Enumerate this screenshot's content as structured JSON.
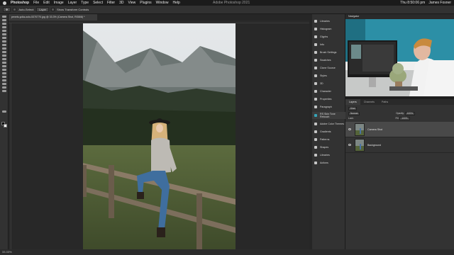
{
  "menubar": {
    "app": "Photoshop",
    "menus": [
      "File",
      "Edit",
      "Image",
      "Layer",
      "Type",
      "Select",
      "Filter",
      "3D",
      "View",
      "Plugins",
      "Window",
      "Help"
    ],
    "window_title": "Adobe Photoshop 2021",
    "clock": "Thu 8:50:06 pm",
    "user": "James Fosner"
  },
  "options_bar": {
    "select_label": "Auto-Select:",
    "select_value": "Layer",
    "transform_label": "Show Transform Controls"
  },
  "document": {
    "tab_title": "pexels-yulia-oolo-5370770.jpg @ 33.3% (Camera Shot, RGB/8) *"
  },
  "status": {
    "zoom": "33.33%"
  },
  "panels": [
    {
      "label": "Libraries",
      "icon": "libraries-icon"
    },
    {
      "label": "Histogram",
      "icon": "histogram-icon"
    },
    {
      "label": "Glyphs",
      "icon": "glyphs-icon"
    },
    {
      "label": "Info",
      "icon": "info-icon"
    },
    {
      "label": "Brush Settings",
      "icon": "brush-icon"
    },
    {
      "label": "Swatches",
      "icon": "swatches-icon"
    },
    {
      "label": "Clone Source",
      "icon": "clone-icon"
    },
    {
      "label": "Styles",
      "icon": "styles-icon"
    },
    {
      "label": "3D",
      "icon": "3d-icon"
    },
    {
      "label": "Character",
      "icon": "character-icon"
    },
    {
      "label": "Properties",
      "icon": "properties-icon"
    },
    {
      "label": "Paragraph",
      "icon": "paragraph-icon"
    },
    {
      "label": "RS Skin Tone Retouch",
      "icon": "plugin-icon"
    },
    {
      "label": "Adobe Color Themes",
      "icon": "color-themes-icon"
    },
    {
      "label": "Gradients",
      "icon": "gradients-icon"
    },
    {
      "label": "Patterns",
      "icon": "patterns-icon"
    },
    {
      "label": "Shapes",
      "icon": "shapes-icon"
    },
    {
      "label": "Libraries",
      "icon": "libraries-icon"
    },
    {
      "label": "Actions",
      "icon": "actions-icon"
    }
  ],
  "navigator": {
    "title": "Navigator"
  },
  "layers_panel": {
    "tabs": [
      "Layers",
      "Channels",
      "Paths"
    ],
    "kind_label": "Kind",
    "blend_mode": "Normal",
    "opacity_label": "Opacity:",
    "opacity_value": "100%",
    "lock_label": "Lock:",
    "fill_label": "Fill:",
    "fill_value": "100%",
    "layers": [
      {
        "name": "Camera Shot",
        "selected": true
      },
      {
        "name": "Background",
        "selected": false
      }
    ]
  },
  "colors": {
    "accent": "#35a4b7",
    "panel": "#323232",
    "background": "#1e1e1e"
  }
}
